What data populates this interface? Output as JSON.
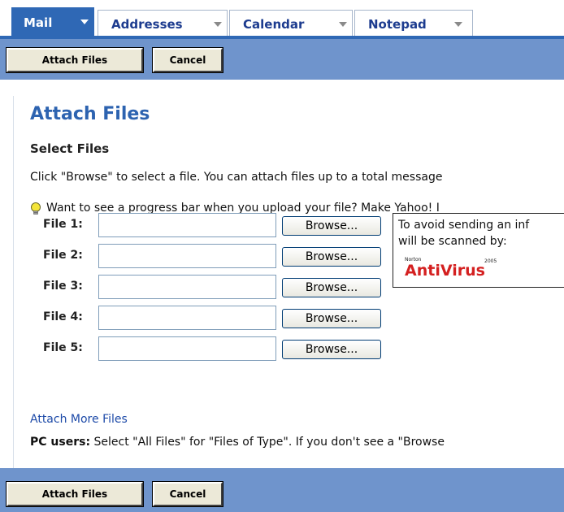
{
  "tabs": [
    {
      "label": "Mail",
      "active": true
    },
    {
      "label": "Addresses",
      "active": false
    },
    {
      "label": "Calendar",
      "active": false
    },
    {
      "label": "Notepad",
      "active": false
    }
  ],
  "toolbar": {
    "attach_label": "Attach Files",
    "cancel_label": "Cancel"
  },
  "page": {
    "title": "Attach Files",
    "section_title": "Select Files",
    "instructions": "Click \"Browse\" to select a file. You can attach files up to a total message",
    "tip": "Want to see a progress bar when you upload your file? Make Yahoo! I",
    "tip_icon": "lightbulb-icon"
  },
  "files": [
    {
      "label": "File 1:",
      "value": "",
      "browse_label": "Browse..."
    },
    {
      "label": "File 2:",
      "value": "",
      "browse_label": "Browse..."
    },
    {
      "label": "File 3:",
      "value": "",
      "browse_label": "Browse..."
    },
    {
      "label": "File 4:",
      "value": "",
      "browse_label": "Browse..."
    },
    {
      "label": "File 5:",
      "value": "",
      "browse_label": "Browse..."
    }
  ],
  "scan_notice": {
    "line1": "To avoid sending an inf",
    "line2": "will be scanned by:",
    "logo_small": "Norton",
    "logo_main": "AntiVirus",
    "logo_year": "2005"
  },
  "attach_more_label": "Attach More Files",
  "pc_users": {
    "bold": "PC users:",
    "text": " Select \"All Files\" for \"Files of Type\". If you don't see a \"Browse"
  },
  "colors": {
    "tab_active": "#2f68b5",
    "toolbar": "#6f94cc",
    "title": "#2d63b0",
    "link": "#1d4aa8",
    "antivirus_red": "#d42020"
  }
}
